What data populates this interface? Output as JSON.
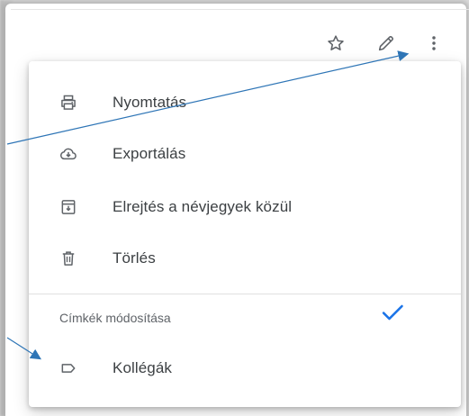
{
  "toolbar": {
    "star_icon": "star-outline-icon",
    "edit_icon": "pencil-icon",
    "more_icon": "more-vertical-icon"
  },
  "menu": {
    "items": [
      {
        "label": "Nyomtatás",
        "icon": "printer-icon"
      },
      {
        "label": "Exportálás",
        "icon": "cloud-download-icon"
      },
      {
        "label": "Elrejtés a névjegyek közül",
        "icon": "archive-icon"
      },
      {
        "label": "Törlés",
        "icon": "trash-icon"
      }
    ],
    "labels_heading": "Címkék módosítása",
    "labels": [
      {
        "label": "Kollégák",
        "icon": "label-outline-icon",
        "checked": true
      }
    ]
  },
  "colors": {
    "accent": "#1a73e8",
    "icon": "#5f6368",
    "text": "#3c4043",
    "annotation": "#2e75b6"
  }
}
